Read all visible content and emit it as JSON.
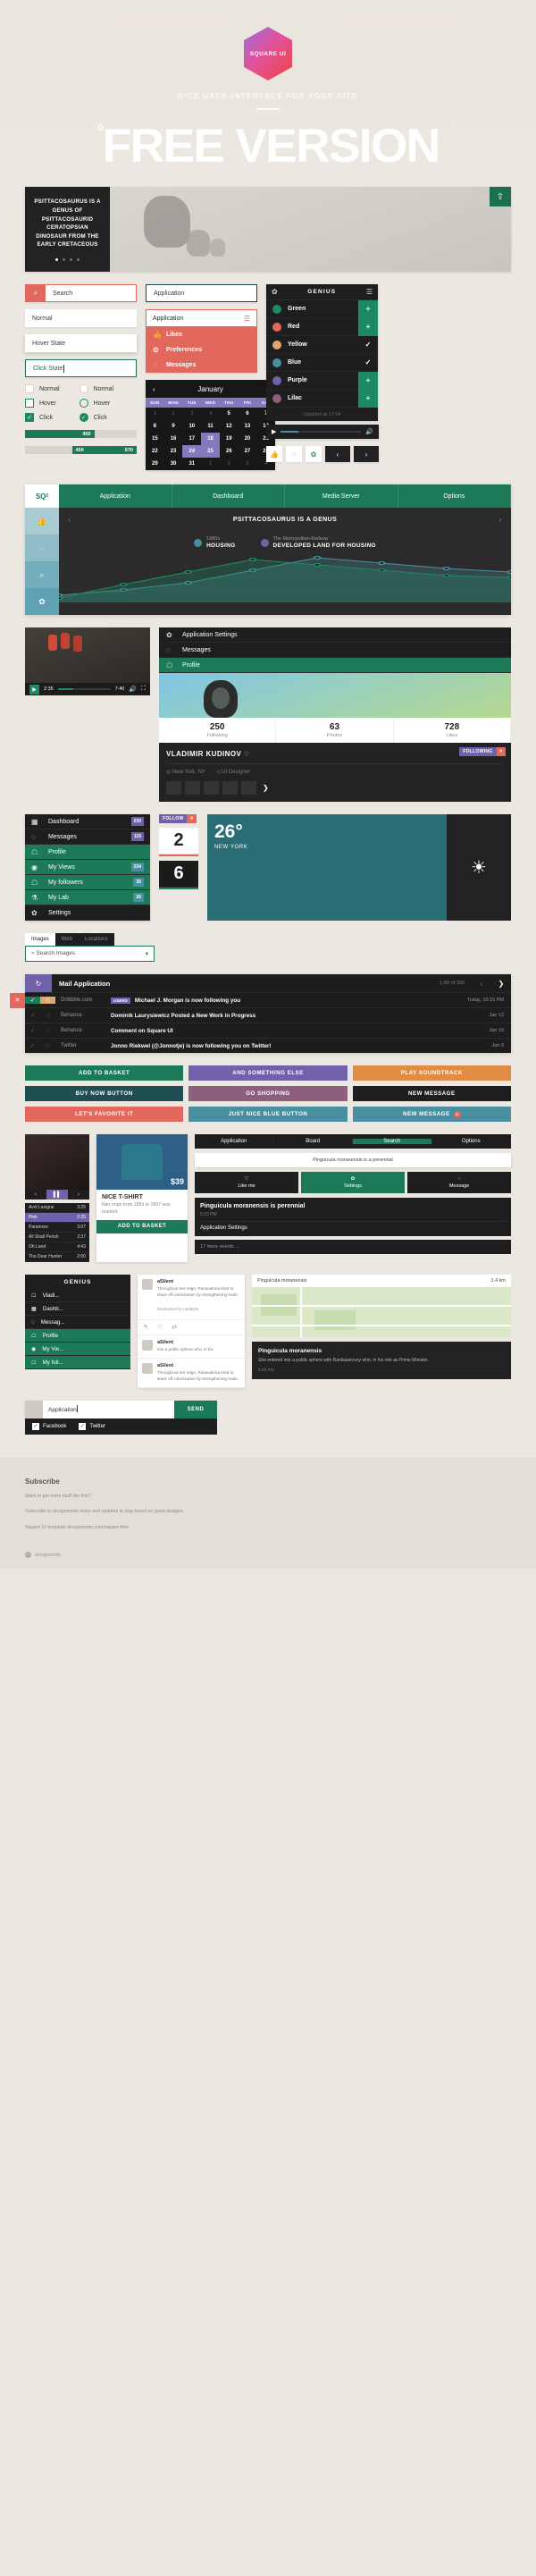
{
  "hero": {
    "logo_text": "SQUARE UI",
    "subtitle": "NICE USER INTERFACE FOR YOUR SITE",
    "title": "FREE VERSION",
    "degree_mark": "°"
  },
  "slider": {
    "headline": "PSITTACOSAURUS IS A GENUS OF PSITTACOSAURID CERATOPSIAN DINOSAUR FROM THE EARLY CRETACEOUS",
    "badge_icon": "share-icon",
    "dots": 4,
    "active_dot": 0
  },
  "forms": {
    "search_placeholder": "Search",
    "search_icon": "search-icon",
    "application_outline": "Application",
    "normal": "Normal",
    "hover": "Hover State",
    "click": "Click State",
    "dropdown": {
      "label": "Application",
      "menu_icon": "hamburger-icon",
      "items": [
        {
          "icon": "thumbs-up-icon",
          "label": "Likes"
        },
        {
          "icon": "gear-icon",
          "label": "Preferences"
        },
        {
          "icon": "chat-icon",
          "label": "Messages"
        }
      ]
    },
    "iconbar": [
      "thumbs-up-icon",
      "chat-icon",
      "gear-icon"
    ],
    "pager": [
      "prev-icon",
      "next-icon"
    ]
  },
  "genius": {
    "title": "GENIUS",
    "gear_icon": "gear-icon",
    "menu_icon": "hamburger-icon",
    "footer": "Updated at 17:04",
    "rows": [
      {
        "name": "Green",
        "color": "#1d8a63",
        "action": "+",
        "state": "add"
      },
      {
        "name": "Red",
        "color": "#e2685d",
        "action": "+",
        "state": "add"
      },
      {
        "name": "Yellow",
        "color": "#e0a86b",
        "action": "✓",
        "state": "done"
      },
      {
        "name": "Blue",
        "color": "#4a8fa0",
        "action": "✓",
        "state": "done"
      },
      {
        "name": "Purple",
        "color": "#6f62ab",
        "action": "+",
        "state": "add"
      },
      {
        "name": "Lilac",
        "color": "#8e5f7d",
        "action": "+",
        "state": "add"
      }
    ],
    "player": {
      "play_icon": "play-icon",
      "volume_icon": "volume-icon",
      "progress": 22
    }
  },
  "calendar": {
    "month": "January",
    "prev_icon": "chevron-left-icon",
    "next_icon": "chevron-right-icon",
    "dow": [
      "SUN",
      "MON",
      "TUE",
      "WED",
      "THU",
      "FRI",
      "SAT"
    ],
    "weeks": [
      [
        {
          "d": "1",
          "mute": true
        },
        {
          "d": "2",
          "mute": true
        },
        {
          "d": "3",
          "mute": true
        },
        {
          "d": "4",
          "mute": true
        },
        {
          "d": "5"
        },
        {
          "d": "6"
        },
        {
          "d": "7"
        }
      ],
      [
        {
          "d": "8"
        },
        {
          "d": "9"
        },
        {
          "d": "10"
        },
        {
          "d": "11"
        },
        {
          "d": "12"
        },
        {
          "d": "13"
        },
        {
          "d": "14"
        }
      ],
      [
        {
          "d": "15"
        },
        {
          "d": "16"
        },
        {
          "d": "17"
        },
        {
          "d": "18",
          "sel": true
        },
        {
          "d": "19"
        },
        {
          "d": "20"
        },
        {
          "d": "21"
        }
      ],
      [
        {
          "d": "22"
        },
        {
          "d": "23"
        },
        {
          "d": "24",
          "sel": true
        },
        {
          "d": "25",
          "sel": true
        },
        {
          "d": "26"
        },
        {
          "d": "27"
        },
        {
          "d": "28"
        }
      ],
      [
        {
          "d": "29"
        },
        {
          "d": "30"
        },
        {
          "d": "31"
        },
        {
          "d": "1",
          "mute": true
        },
        {
          "d": "2",
          "mute": true
        },
        {
          "d": "3",
          "mute": true
        },
        {
          "d": "4",
          "mute": true
        }
      ]
    ]
  },
  "controls": {
    "checkbox": [
      "Normal",
      "Hover",
      "Click"
    ],
    "radio": [
      "Normal",
      "Hover",
      "Click"
    ],
    "slider_single": {
      "value": "450",
      "percent": 62
    },
    "slider_range": {
      "from": "450",
      "to": "670",
      "start": 42,
      "end": 100
    }
  },
  "dashboard": {
    "logo": "SQ",
    "logo_sup": "2",
    "nav": [
      "Application",
      "Dashboard",
      "Media Server",
      "Options"
    ],
    "nav_caret": "chevron-down-icon",
    "sidebar": [
      "thumbs-up-icon",
      "chat-icon",
      "search-icon",
      "gear-icon"
    ],
    "title": "PSITTACOSAURUS IS A GENUS",
    "prev_icon": "chevron-left-icon",
    "next_icon": "chevron-right-icon",
    "legend": [
      {
        "sub": "1980s",
        "label": "HOUSING",
        "color": "#4a8fa0"
      },
      {
        "sub": "The Metropolitan Railway",
        "label": "DEVELOPED LAND FOR HOUSING",
        "color": "#6f62ab"
      }
    ],
    "chart_data": {
      "type": "area",
      "title": "PSITTACOSAURUS IS A GENUS",
      "x": [
        0,
        1,
        2,
        3,
        4,
        5,
        6,
        7
      ],
      "series": [
        {
          "name": "HOUSING",
          "color": "#4a8fa0",
          "values": [
            8,
            14,
            22,
            36,
            50,
            44,
            38,
            34
          ]
        },
        {
          "name": "DEVELOPED LAND FOR HOUSING",
          "color": "#1d8a63",
          "values": [
            5,
            20,
            34,
            48,
            42,
            36,
            30,
            28
          ]
        }
      ],
      "ylim": [
        0,
        56
      ],
      "grid": true,
      "legend": "top"
    }
  },
  "video": {
    "time_current": "2:35",
    "time_total": "7:40",
    "play_icon": "play-icon",
    "volume_icon": "volume-icon",
    "fullscreen_icon": "fullscreen-icon",
    "progress": 30
  },
  "profile": {
    "menu": [
      {
        "icon": "gear-icon",
        "label": "Application Settings",
        "active": false
      },
      {
        "icon": "chat-icon",
        "label": "Messages",
        "active": false
      },
      {
        "icon": "user-icon",
        "label": "Profile",
        "active": true
      }
    ],
    "stats": [
      {
        "value": "250",
        "label": "Following"
      },
      {
        "value": "63",
        "label": "Photos"
      },
      {
        "value": "728",
        "label": "Likes"
      }
    ],
    "name": "VLADIMIR KUDINOV",
    "heart_icon": "heart-icon",
    "location": "New York, NY",
    "location_icon": "pin-icon",
    "role": "UI Designer",
    "role_icon": "tag-icon",
    "tag": "FOLLOWING",
    "tag_close": "✕",
    "next_icon": "chevron-right-icon",
    "thumb_count": 5
  },
  "sidemenu": {
    "items": [
      {
        "icon": "dashboard-icon",
        "label": "Dashboard",
        "badge": "230",
        "badge_color": "purple",
        "active": false
      },
      {
        "icon": "chat-icon",
        "label": "Messages",
        "badge": "115",
        "badge_color": "purple",
        "active": false
      },
      {
        "icon": "user-icon",
        "label": "Profile",
        "badge": "",
        "badge_color": "",
        "active": true
      },
      {
        "icon": "eye-icon",
        "label": "My Views",
        "badge": "234",
        "badge_color": "blue",
        "active": true
      },
      {
        "icon": "user-icon",
        "label": "My followers",
        "badge": "35",
        "badge_color": "blue",
        "active": true
      },
      {
        "icon": "flask-icon",
        "label": "My Lab",
        "badge": "26",
        "badge_color": "blue",
        "active": true
      },
      {
        "icon": "gear-icon",
        "label": "Settings",
        "badge": "",
        "badge_color": "",
        "active": false
      }
    ],
    "follow_tag": "FOLLOW",
    "follow_close": "✕",
    "counter_light": "2",
    "counter_dark": "6"
  },
  "weather": {
    "temperature": "26°",
    "city": "NEW YORK",
    "icon": "sun-icon"
  },
  "search_images": {
    "tabs": [
      "Images",
      "Web",
      "Locations"
    ],
    "active_tab": "Images",
    "placeholder": "Search Images",
    "search_icon": "search-icon",
    "caret_icon": "chevron-down-icon"
  },
  "mail": {
    "title": "Mail Application",
    "refresh_icon": "refresh-icon",
    "count": "1-50 of 300",
    "prev_icon": "chevron-left-icon",
    "next_icon": "chevron-right-icon",
    "delete_icon": "✕",
    "rows": [
      {
        "source": "Dribbble.com",
        "label": "USERS",
        "subject": "Michael J. Morgan is now following you",
        "date": "Today, 10:15 PM",
        "checked": true,
        "starred": true
      },
      {
        "source": "Behance",
        "label": "",
        "subject": "Dominik Laurysiewicz Posted a New Work in Progress",
        "date": "Jan 12",
        "checked": false,
        "starred": false
      },
      {
        "source": "Behance",
        "label": "",
        "subject": "Comment on Square UI",
        "date": "Jan 10",
        "checked": false,
        "starred": false
      },
      {
        "source": "Twitter",
        "label": "",
        "subject": "Jonno Riekwel (@Jonnotje) is now following you on Twitter!",
        "date": "Jan 9",
        "checked": false,
        "starred": false
      }
    ]
  },
  "buttons": [
    {
      "label": "ADD TO BASKET",
      "color": "#1d7a58",
      "badge": ""
    },
    {
      "label": "AND SOMETHING ELSE",
      "color": "#6f62ab",
      "badge": ""
    },
    {
      "label": "PLAY SOUNDTRACK",
      "color": "#e08c45",
      "badge": ""
    },
    {
      "label": "BUY NOW BUTTON",
      "color": "#1e4d52",
      "badge": ""
    },
    {
      "label": "GO SHOPPING",
      "color": "#8e5f7d",
      "badge": ""
    },
    {
      "label": "NEW MESSAGE",
      "color": "#1e1e1e",
      "badge": ""
    },
    {
      "label": "LET'S FAVORITE IT",
      "color": "#e2685d",
      "badge": ""
    },
    {
      "label": "JUST NICE BLUE BUTTON",
      "color": "#4a8fa0",
      "badge": ""
    },
    {
      "label": "NEW MESSAGE",
      "color": "#4a8fa0",
      "badge": "2"
    }
  ],
  "music": {
    "rail": [
      "prev-icon",
      "play-icon",
      "next-icon"
    ],
    "tracks": [
      {
        "name": "Avril Lavigne",
        "time": "3:25",
        "active": false
      },
      {
        "name": "Pink",
        "time": "2:25",
        "active": true
      },
      {
        "name": "Paramore",
        "time": "3:07",
        "active": false
      },
      {
        "name": "All Shall Perish",
        "time": "2:37",
        "active": false
      },
      {
        "name": "Oh Land",
        "time": "4:43",
        "active": false
      },
      {
        "name": "The Dear Hunter",
        "time": "2:00",
        "active": false
      }
    ]
  },
  "product": {
    "price": "$39",
    "title": "NICE T-SHIRT",
    "desc": "Nier reign from 1883 to 1897 was marked.",
    "cta": "ADD TO BASKET"
  },
  "rightpanel": {
    "nav": [
      "Application",
      "Board",
      "Search",
      "Options"
    ],
    "active_nav": "Search",
    "search_icon": "search-icon",
    "tooltip": "Pinguicula moranensis is a perennial",
    "actions": [
      {
        "icon": "heart-icon",
        "label": "Like me",
        "active": false
      },
      {
        "icon": "gear-icon",
        "label": "Settings",
        "active": true
      },
      {
        "icon": "chat-icon",
        "label": "Message",
        "active": false
      }
    ],
    "card_title": "Pinguicula moranensis is perennial",
    "card_time": "5:20 PM",
    "card_link": "Application Settings",
    "events": "17 more events →"
  },
  "feed": {
    "title": "GENIUS",
    "items": [
      {
        "icon": "dashboard-icon",
        "label": "Dashb...",
        "active": false
      },
      {
        "icon": "chat-icon",
        "label": "Messag...",
        "active": false
      },
      {
        "icon": "user-icon",
        "label": "Profile",
        "active": true
      },
      {
        "icon": "eye-icon",
        "label": "My Vie...",
        "active": true
      },
      {
        "icon": "user-icon",
        "label": "My foll...",
        "active": true
      }
    ],
    "vlad_tag": "Vladi...",
    "posts": [
      {
        "author": "aSilent",
        "text": "Throughout her reign, Ranavalona tried to stave off colonization by strengthening trade.",
        "meta": "Retweeted by mudBlyte"
      },
      {
        "author": "aSilent",
        "text": "into a public sphere who, in fra"
      },
      {
        "author": "aSilent",
        "text": "Throughout her reign, Ranavalona tried to stave off colonization by strengthening trade."
      }
    ],
    "react_icons": [
      "reply-icon",
      "heart-icon",
      "retweet-icon"
    ]
  },
  "map": {
    "title": "Pinguicula moranensis",
    "meta": "1.4 km",
    "note_title": "Pinguicula moranensis",
    "note_text": "She entered into a public sphere with Ranilaiarivony who, in his role as Prime Minister.",
    "note_time": "5:20 PM"
  },
  "comment": {
    "value": "Application",
    "send": "SEND",
    "checkboxes": [
      {
        "label": "Facebook",
        "checked": true
      },
      {
        "label": "Twitter",
        "checked": true
      }
    ]
  },
  "footer": {
    "title": "Subscribe",
    "line1": "Want to get more stuff like this?",
    "line2": "Subscribe to designmodo news and updates to stay tuned on great designs.",
    "line3": "Square UI template designmodo.com/square-free",
    "credit": "designmodo"
  }
}
